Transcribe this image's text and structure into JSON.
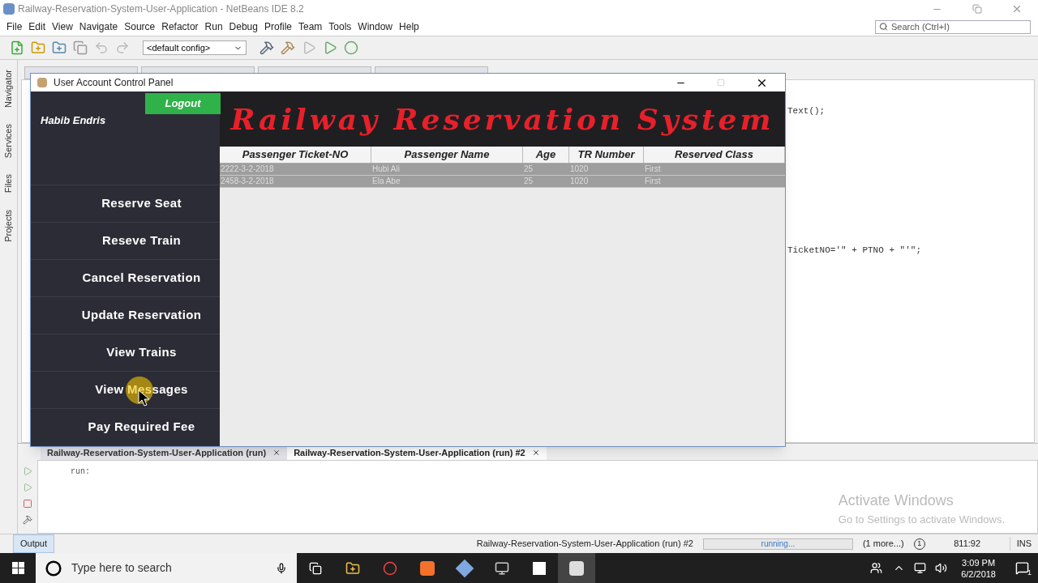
{
  "window": {
    "title": "Railway-Reservation-System-User-Application - NetBeans IDE 8.2"
  },
  "menu": [
    "File",
    "Edit",
    "View",
    "Navigate",
    "Source",
    "Refactor",
    "Run",
    "Debug",
    "Profile",
    "Team",
    "Tools",
    "Window",
    "Help"
  ],
  "toolbar": {
    "config": "<default config>"
  },
  "search": {
    "placeholder": "Search (Ctrl+I)"
  },
  "side_tabs": [
    "Navigator",
    "Services",
    "Files",
    "Projects"
  ],
  "editor": {
    "lines": [
      {
        "text": "Text();"
      },
      {
        "text": "TicketNO='\" + PTNO + \"'\";"
      }
    ]
  },
  "dialog": {
    "title": "User Account Control Panel",
    "user": "Habib Endris",
    "logout": "Logout",
    "banner": "Railway Reservation System",
    "menu": [
      "Reserve Seat",
      "Reseve Train",
      "Cancel Reservation",
      "Update Reservation",
      "View Trains",
      "View Messages",
      "Pay Required Fee"
    ],
    "table": {
      "columns": [
        "Passenger Ticket-NO",
        "Passenger Name",
        "Age",
        "TR Number",
        "Reserved Class"
      ],
      "rows": [
        [
          "2222-3-2-2018",
          "Hubi Ali",
          "25",
          "1020",
          "First"
        ],
        [
          "2458-3-2-2018",
          "Ela Abe",
          "25",
          "1020",
          "First"
        ]
      ]
    }
  },
  "output": {
    "tabs": [
      {
        "label": "Railway-Reservation-System-User-Application (run)",
        "selected": false
      },
      {
        "label": "Railway-Reservation-System-User-Application (run) #2",
        "selected": true
      }
    ],
    "text": "run:",
    "watermark_title": "Activate Windows",
    "watermark_text": "Go to Settings to activate Windows."
  },
  "status_bar": {
    "output_tab": "Output",
    "task": "Railway-Reservation-System-User-Application (run) #2",
    "progress": "running...",
    "more": "(1 more...)",
    "notifications": "1",
    "position": "811:92",
    "mode": "INS"
  },
  "taskbar": {
    "search_placeholder": "Type here to search",
    "time": "3:09 PM",
    "date": "6/2/2018",
    "notifications": "1"
  }
}
